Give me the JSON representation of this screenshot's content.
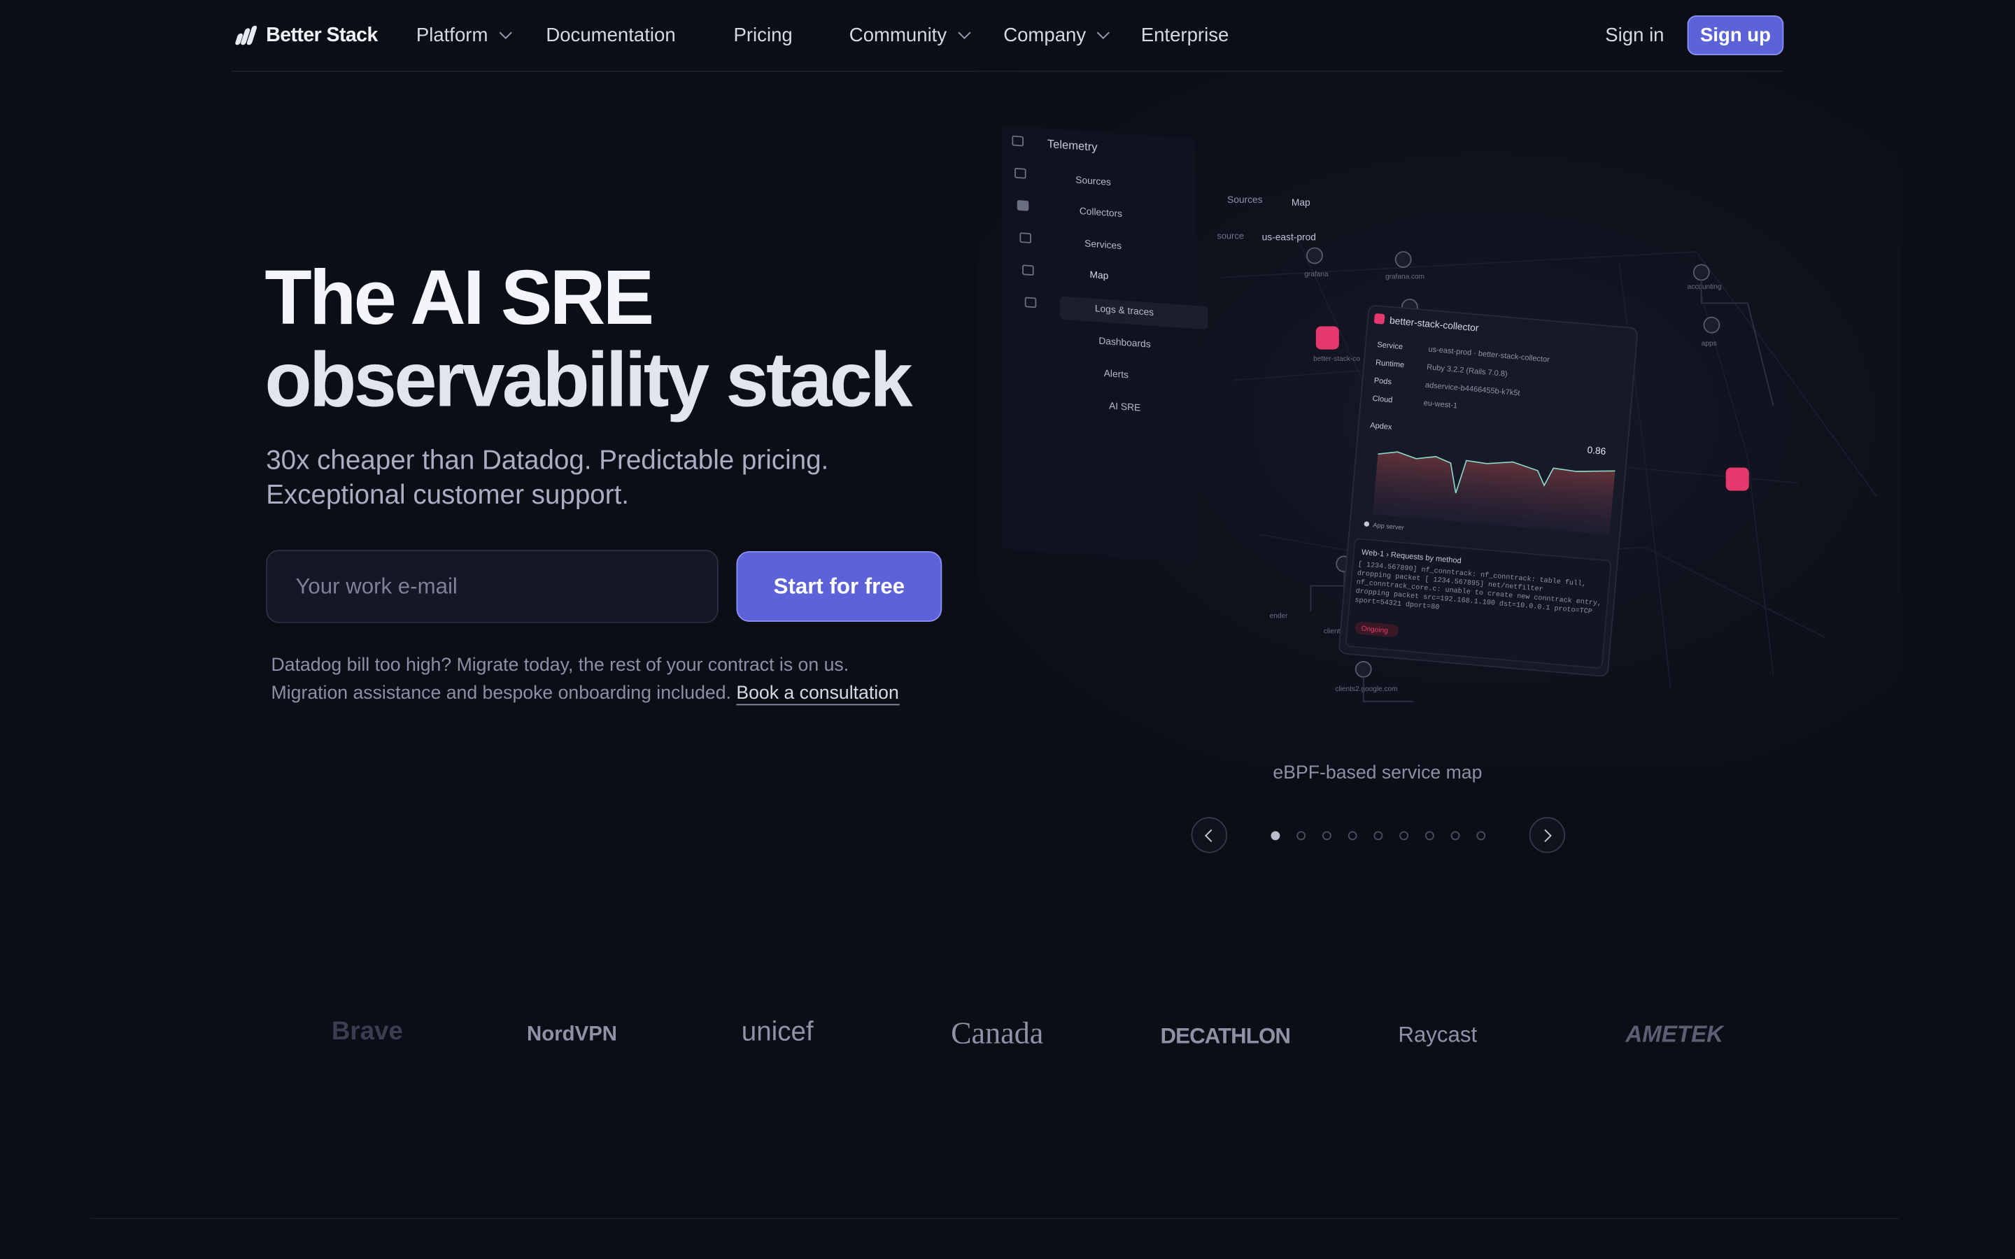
{
  "nav": {
    "brand": "Better Stack",
    "items": [
      {
        "label": "Platform",
        "dropdown": true
      },
      {
        "label": "Documentation",
        "dropdown": false
      },
      {
        "label": "Pricing",
        "dropdown": false
      },
      {
        "label": "Community",
        "dropdown": true
      },
      {
        "label": "Company",
        "dropdown": true
      },
      {
        "label": "Enterprise",
        "dropdown": false
      }
    ],
    "sign_in": "Sign in",
    "sign_up": "Sign up"
  },
  "hero": {
    "title_line1": "The AI SRE",
    "title_line2": "observability stack",
    "subtitle_line1": "30x cheaper than Datadog. Predictable pricing.",
    "subtitle_line2": "Exceptional customer support.",
    "email_placeholder": "Your work e-mail",
    "cta": "Start for free",
    "note_line1": "Datadog bill too high? Migrate today, the rest of your contract is on us.",
    "note_line2": "Migration assistance and bespoke onboarding included.",
    "note_link": "Book a consultation"
  },
  "illustration": {
    "sidebar_title": "Telemetry",
    "sidebar_items": [
      "Sources",
      "Collectors",
      "Services",
      "Map",
      "Logs & traces",
      "Dashboards",
      "Alerts",
      "AI SRE"
    ],
    "breadcrumb": [
      "Sources",
      "Map"
    ],
    "source_label": "source",
    "source_value": "us-east-prod",
    "card_title": "better-stack-collector",
    "card_rows": [
      {
        "k": "Service",
        "v": "us-east-prod  ·  better-stack-collector"
      },
      {
        "k": "Runtime",
        "v": "Ruby 3.2.2 (Rails 7.0.8)"
      },
      {
        "k": "Pods",
        "v": "adservice-b4466455b-k7k5t"
      },
      {
        "k": "Cloud",
        "v": "eu-west-1"
      }
    ],
    "apdex_label": "Apdex",
    "apdex_value": "0.86",
    "legend": "App server",
    "log_title": "Web-1  ›  Requests by method",
    "log_text": "[ 1234.567890] nf_conntrack: nf_conntrack: table full, dropping packet [ 1234.567895] net/netfilter nf_conntrack_core.c: unable to create new conntrack entry, dropping packet src=192.168.1.100 dst=10.0.0.1 proto=TCP sport=54321 dport=80",
    "log_badge": "Ongoing",
    "node_labels": [
      "grafana",
      "grafana.com",
      "accounting",
      "apps",
      "better-stack-co",
      "clients1.google.com",
      "clients2.google.com",
      "ender"
    ],
    "caption": "eBPF-based service map"
  },
  "pager": {
    "pages": 9,
    "active": 1
  },
  "logos": [
    "Brave",
    "NordVPN",
    "unicef",
    "Canada",
    "DECATHLON",
    "Raycast",
    "AMETEK"
  ],
  "colors": {
    "background": "#0b0d17",
    "accent": "#5c63d8",
    "alert": "#e5386f"
  }
}
